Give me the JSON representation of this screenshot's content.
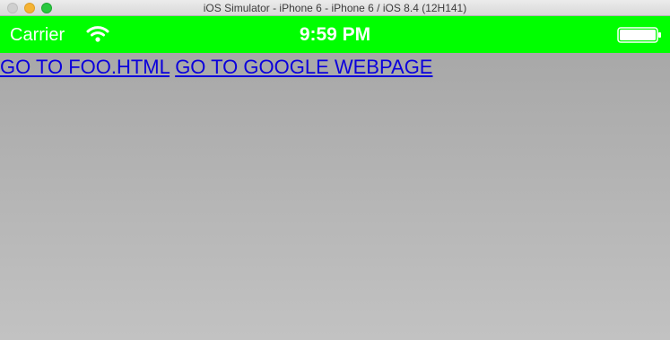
{
  "window": {
    "title": "iOS Simulator - iPhone 6 - iPhone 6 / iOS 8.4 (12H141)"
  },
  "statusbar": {
    "carrier": "Carrier",
    "time": "9:59 PM",
    "background_color": "#00ff00",
    "wifi_icon": "wifi-icon",
    "battery_icon": "battery-icon",
    "battery_level": 1.0
  },
  "webview": {
    "links": [
      {
        "label": "GO TO FOO.HTML"
      },
      {
        "label": "GO TO GOOGLE WEBPAGE"
      }
    ],
    "link_color": "#0b00dc"
  }
}
